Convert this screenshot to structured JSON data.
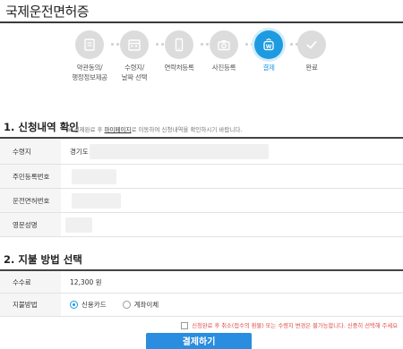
{
  "page": {
    "title": "국제운전면허증"
  },
  "steps": [
    {
      "label": "약관동의/\n행정정보제공",
      "icon": "document-icon",
      "active": false
    },
    {
      "label": "수령지/\n날짜 선택",
      "icon": "calendar-icon",
      "active": false
    },
    {
      "label": "연락처등록",
      "icon": "phone-icon",
      "active": false
    },
    {
      "label": "사진등록",
      "icon": "camera-icon",
      "active": false
    },
    {
      "label": "결제",
      "icon": "won-coin-icon",
      "active": true
    },
    {
      "label": "완료",
      "icon": "checkmark-icon",
      "active": false
    }
  ],
  "section1": {
    "title": "1. 신청내역 확인",
    "note_prefix": "※ 결제완료 후 ",
    "note_link": "마이페이지",
    "note_suffix": "로 이동하여 신청내역을 확인하시기 바랍니다.",
    "rows": [
      {
        "label": "수령지",
        "value": "경기도"
      },
      {
        "label": "주민등록번호",
        "value": ""
      },
      {
        "label": "운전면허번호",
        "value": ""
      },
      {
        "label": "영문성명",
        "value": ""
      }
    ]
  },
  "section2": {
    "title": "2. 지불 방법 선택",
    "fee_label": "수수료",
    "fee_value": "12,300 원",
    "method_label": "지불방법",
    "options": [
      {
        "label": "신용카드",
        "checked": true
      },
      {
        "label": "계좌이체",
        "checked": false
      }
    ]
  },
  "consent": {
    "text": "신청완료 후 취소(접수의 환불) 또는 수령지 변경은 불가능합니다. 신중히 선택해 주세요"
  },
  "pay_button": {
    "label": "결제하기"
  },
  "colors": {
    "accent": "#1e9be0",
    "button": "#2a8de0",
    "warning": "#e24848"
  }
}
